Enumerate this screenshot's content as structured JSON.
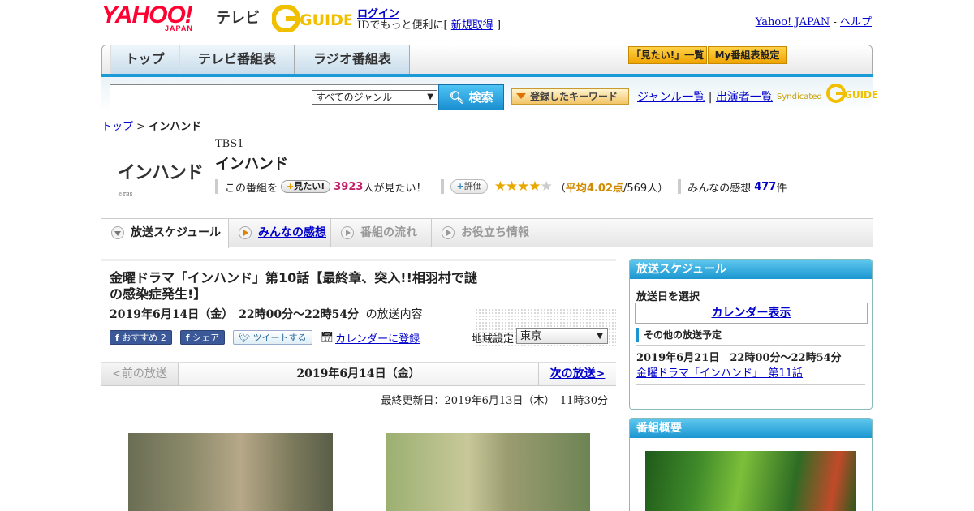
{
  "header": {
    "yahoo_logo": "YAHOO!",
    "yahoo_sub": "JAPAN",
    "tv_label": "テレビ",
    "gguide_logo": "G-GUIDE",
    "login_label": "ログイン",
    "login_sub_prefix": "IDでもっと便利に[",
    "signup_label": "新規取得",
    "login_sub_suffix": "]",
    "yahoo_japan_link": "Yahoo! JAPAN",
    "link_sep": "-",
    "help_link": "ヘルプ"
  },
  "nav": {
    "tabs": [
      "トップ",
      "テレビ番組表",
      "ラジオ番組表"
    ],
    "mitai_list": "「見たい!」一覧",
    "my_table": "My番組表設定"
  },
  "search": {
    "genre_selected": "すべてのジャンル",
    "search_button": "検索",
    "keyword_button": "登録したキーワード",
    "genre_list_link": "ジャンル一覧",
    "sep": "|",
    "performer_list_link": "出演者一覧",
    "syndicated": "Syndicated"
  },
  "breadcrumb": {
    "top": "トップ",
    "sep": ">",
    "current": "インハンド"
  },
  "program": {
    "logo_text": "インハンド",
    "logo_copy": "©TBS",
    "channel": "TBS1",
    "title": "インハンド",
    "mitai_prefix": "この番組を",
    "mitai_button": "見たい!",
    "mitai_count": "3923",
    "mitai_suffix": "人が見たい！",
    "hyoka_button": "評価",
    "rating": 4.02,
    "stars_filled": "★★★★",
    "stars_empty": "★",
    "rating_open": "（",
    "rating_avg_label": "平均4.02点",
    "rating_count": "/569人）",
    "kansou_label": "みんなの感想",
    "kansou_count": "477",
    "kansou_suffix": "件"
  },
  "subtabs": [
    "放送スケジュール",
    "みんなの感想",
    "番組の流れ",
    "お役立ち情報"
  ],
  "episode": {
    "title": "金曜ドラマ「インハンド」第10話【最終章、突入!!相羽村で謎の感染症発生!】",
    "date": "2019年6月14日（金）　22時00分～22時54分",
    "date_suffix": "の放送内容",
    "fb_recommend": "おすすめ 2",
    "fb_share": "シェア",
    "tweet": "ツイートする",
    "calendar_register": "カレンダーに登録",
    "area_label": "地域設定",
    "area_selected": "東京"
  },
  "pager": {
    "prev": "<前の放送",
    "date": "2019年6月14日（金）",
    "next": "次の放送>"
  },
  "updated": "最終更新日：2019年6月13日（木）　11時30分",
  "sidebar": {
    "schedule_title": "放送スケジュール",
    "select_date": "放送日を選択",
    "calendar_display": "カレンダー表示",
    "other_schedule": "その他の放送予定",
    "next_date": "2019年6月21日　22時00分～22時54分",
    "next_episode": "金曜ドラマ「インハンド」　第11話",
    "overview_title": "番組概要"
  },
  "colors": {
    "accent_blue": "#1a9ad6",
    "yahoo_red": "#ff0033",
    "gguide_yellow": "#f0c000"
  }
}
